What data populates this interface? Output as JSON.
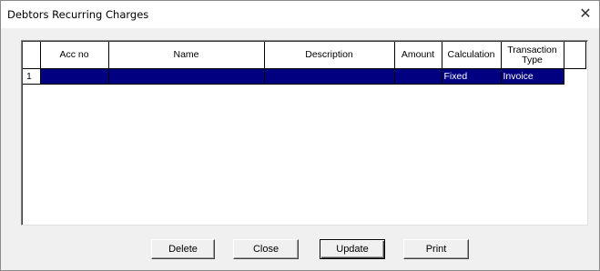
{
  "window": {
    "title": "Debtors Recurring Charges",
    "close_glyph": "✕"
  },
  "grid": {
    "columns": [
      "",
      "Acc no",
      "Name",
      "Description",
      "Amount",
      "Calculation",
      "Transaction Type",
      ""
    ],
    "rows": [
      {
        "row_number": "1",
        "acc_no": "",
        "name": "",
        "description": "",
        "amount": "",
        "calculation": "Fixed",
        "transaction_type": "Invoice",
        "selected": true
      }
    ],
    "selection_color": "#000080"
  },
  "buttons": {
    "delete": "Delete",
    "close": "Close",
    "update": "Update",
    "print": "Print"
  }
}
